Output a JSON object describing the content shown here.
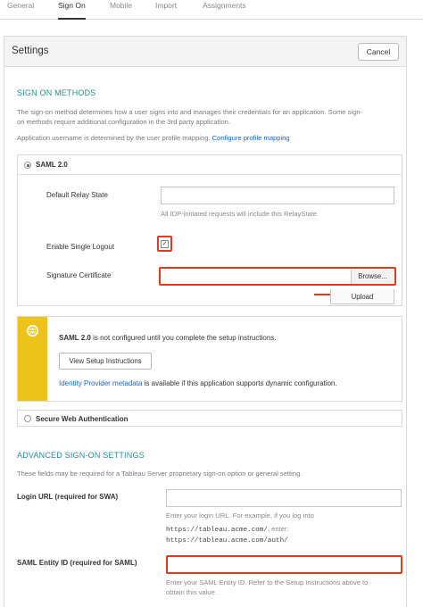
{
  "tabs": [
    {
      "label": "General"
    },
    {
      "label": "Sign On"
    },
    {
      "label": "Mobile"
    },
    {
      "label": "Import"
    },
    {
      "label": "Assignments"
    }
  ],
  "settings": {
    "title": "Settings",
    "cancel_label": "Cancel"
  },
  "sign_on_methods": {
    "heading": "SIGN ON METHODS",
    "description_line1": "The sign-on method determines how a user signs into and manages their credentials for an application. Some sign-",
    "description_line2": "on methods require additional configuration in the 3rd party application.",
    "username_text": "Application username is determined by the user profile mapping.",
    "username_link": "Configure profile mapping"
  },
  "saml": {
    "label": "SAML 2.0",
    "relay_state_label": "Default Relay State",
    "relay_state_value": "",
    "relay_state_hint": "All IDP-initiated requests will include this RelayState",
    "single_logout_label": "Enable Single Logout",
    "single_logout_checked": true,
    "checkbox_mark": "✓",
    "signature_label": "Signature Certificate",
    "signature_value": "",
    "browse_label": "Browse...",
    "upload_label": "Upload"
  },
  "notice": {
    "bold": "SAML 2.0",
    "text": " is not configured until you complete the setup instructions.",
    "button_label": "View Setup Instructions",
    "metadata_link": "Identity Provider metadata",
    "metadata_text": " is available if this application supports dynamic configuration.",
    "accent_color": "#ecc419",
    "icon": "globe-icon"
  },
  "swa": {
    "label": "Secure Web Authentication"
  },
  "advanced": {
    "heading": "ADVANCED SIGN-ON SETTINGS",
    "description": "These fields may be required for a Tableau Server proprietary sign-on option or general setting.",
    "login_url_label": "Login URL (required for SWA)",
    "login_url_value": "",
    "login_url_hint": "Enter your login URL. For example, if you log into",
    "example_url1": "https://tableau.acme.com/",
    "example_mid": ", enter:",
    "example_url2": "https://tableau.acme.com/auth/",
    "entity_id_label": "SAML Entity ID (required for SAML)",
    "entity_id_value": "",
    "entity_hint_line1": "Enter your SAML Entity ID. Refer to the Setup Instructions above to",
    "entity_hint_line2": "obtain this value."
  },
  "colors": {
    "heading": "#2a8a99",
    "link": "#1662dd",
    "highlight": "#e13a1e"
  }
}
